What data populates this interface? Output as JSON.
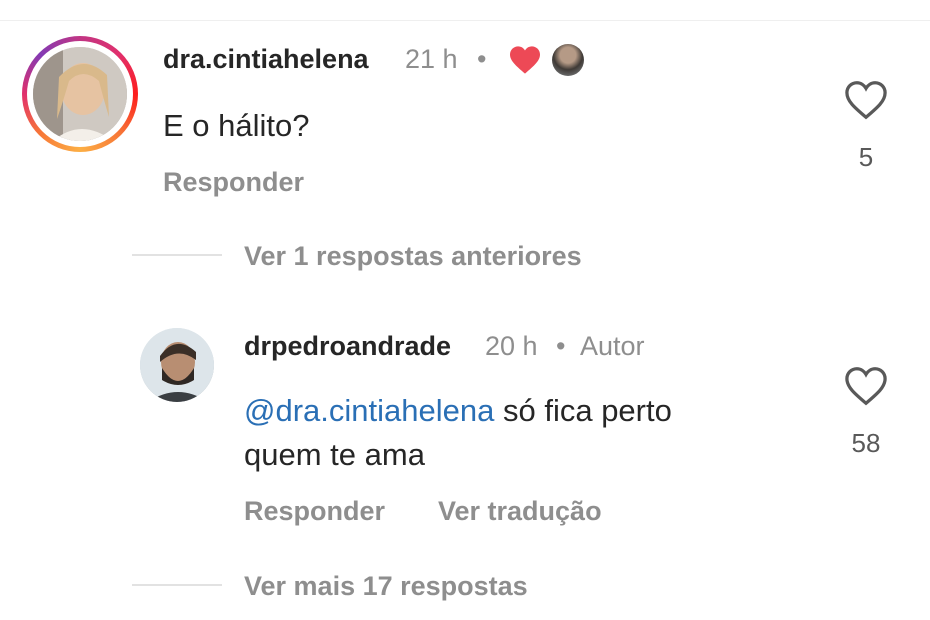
{
  "comment": {
    "username": "dra.cintiahelena",
    "time": "21 h",
    "separator": "•",
    "text": "E o hálito?",
    "like_count": "5",
    "reply_label": "Responder",
    "icons": {
      "liked_by_author": "heart-icon",
      "author_avatar": "avatar"
    },
    "colors": {
      "liked_heart": "#ed4956"
    }
  },
  "previous_replies_label": "Ver 1 respostas anteriores",
  "reply": {
    "username": "drpedroandrade",
    "time": "20 h",
    "separator": "•",
    "badge": "Autor",
    "mention": "@dra.cintiahelena",
    "text_line1": "só fica perto",
    "text_line2": "quem te ama",
    "like_count": "58",
    "reply_label": "Responder",
    "translate_label": "Ver tradução",
    "colors": {
      "mention": "#2a6fb5"
    }
  },
  "more_replies_label": "Ver mais 17 respostas"
}
